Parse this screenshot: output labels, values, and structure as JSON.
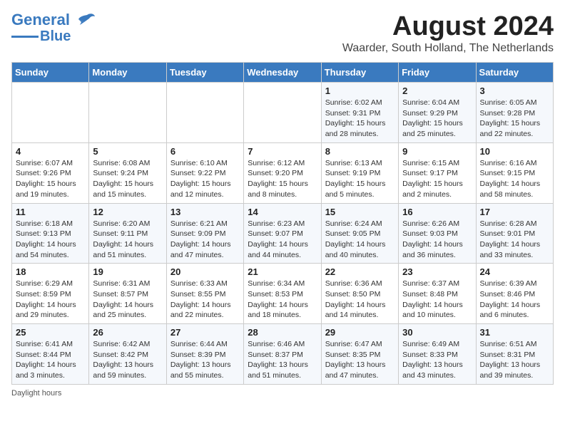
{
  "logo": {
    "line1": "General",
    "line2": "Blue"
  },
  "title": "August 2024",
  "location": "Waarder, South Holland, The Netherlands",
  "days_of_week": [
    "Sunday",
    "Monday",
    "Tuesday",
    "Wednesday",
    "Thursday",
    "Friday",
    "Saturday"
  ],
  "footer": "Daylight hours",
  "weeks": [
    [
      {
        "day": "",
        "info": ""
      },
      {
        "day": "",
        "info": ""
      },
      {
        "day": "",
        "info": ""
      },
      {
        "day": "",
        "info": ""
      },
      {
        "day": "1",
        "info": "Sunrise: 6:02 AM\nSunset: 9:31 PM\nDaylight: 15 hours\nand 28 minutes."
      },
      {
        "day": "2",
        "info": "Sunrise: 6:04 AM\nSunset: 9:29 PM\nDaylight: 15 hours\nand 25 minutes."
      },
      {
        "day": "3",
        "info": "Sunrise: 6:05 AM\nSunset: 9:28 PM\nDaylight: 15 hours\nand 22 minutes."
      }
    ],
    [
      {
        "day": "4",
        "info": "Sunrise: 6:07 AM\nSunset: 9:26 PM\nDaylight: 15 hours\nand 19 minutes."
      },
      {
        "day": "5",
        "info": "Sunrise: 6:08 AM\nSunset: 9:24 PM\nDaylight: 15 hours\nand 15 minutes."
      },
      {
        "day": "6",
        "info": "Sunrise: 6:10 AM\nSunset: 9:22 PM\nDaylight: 15 hours\nand 12 minutes."
      },
      {
        "day": "7",
        "info": "Sunrise: 6:12 AM\nSunset: 9:20 PM\nDaylight: 15 hours\nand 8 minutes."
      },
      {
        "day": "8",
        "info": "Sunrise: 6:13 AM\nSunset: 9:19 PM\nDaylight: 15 hours\nand 5 minutes."
      },
      {
        "day": "9",
        "info": "Sunrise: 6:15 AM\nSunset: 9:17 PM\nDaylight: 15 hours\nand 2 minutes."
      },
      {
        "day": "10",
        "info": "Sunrise: 6:16 AM\nSunset: 9:15 PM\nDaylight: 14 hours\nand 58 minutes."
      }
    ],
    [
      {
        "day": "11",
        "info": "Sunrise: 6:18 AM\nSunset: 9:13 PM\nDaylight: 14 hours\nand 54 minutes."
      },
      {
        "day": "12",
        "info": "Sunrise: 6:20 AM\nSunset: 9:11 PM\nDaylight: 14 hours\nand 51 minutes."
      },
      {
        "day": "13",
        "info": "Sunrise: 6:21 AM\nSunset: 9:09 PM\nDaylight: 14 hours\nand 47 minutes."
      },
      {
        "day": "14",
        "info": "Sunrise: 6:23 AM\nSunset: 9:07 PM\nDaylight: 14 hours\nand 44 minutes."
      },
      {
        "day": "15",
        "info": "Sunrise: 6:24 AM\nSunset: 9:05 PM\nDaylight: 14 hours\nand 40 minutes."
      },
      {
        "day": "16",
        "info": "Sunrise: 6:26 AM\nSunset: 9:03 PM\nDaylight: 14 hours\nand 36 minutes."
      },
      {
        "day": "17",
        "info": "Sunrise: 6:28 AM\nSunset: 9:01 PM\nDaylight: 14 hours\nand 33 minutes."
      }
    ],
    [
      {
        "day": "18",
        "info": "Sunrise: 6:29 AM\nSunset: 8:59 PM\nDaylight: 14 hours\nand 29 minutes."
      },
      {
        "day": "19",
        "info": "Sunrise: 6:31 AM\nSunset: 8:57 PM\nDaylight: 14 hours\nand 25 minutes."
      },
      {
        "day": "20",
        "info": "Sunrise: 6:33 AM\nSunset: 8:55 PM\nDaylight: 14 hours\nand 22 minutes."
      },
      {
        "day": "21",
        "info": "Sunrise: 6:34 AM\nSunset: 8:53 PM\nDaylight: 14 hours\nand 18 minutes."
      },
      {
        "day": "22",
        "info": "Sunrise: 6:36 AM\nSunset: 8:50 PM\nDaylight: 14 hours\nand 14 minutes."
      },
      {
        "day": "23",
        "info": "Sunrise: 6:37 AM\nSunset: 8:48 PM\nDaylight: 14 hours\nand 10 minutes."
      },
      {
        "day": "24",
        "info": "Sunrise: 6:39 AM\nSunset: 8:46 PM\nDaylight: 14 hours\nand 6 minutes."
      }
    ],
    [
      {
        "day": "25",
        "info": "Sunrise: 6:41 AM\nSunset: 8:44 PM\nDaylight: 14 hours\nand 3 minutes."
      },
      {
        "day": "26",
        "info": "Sunrise: 6:42 AM\nSunset: 8:42 PM\nDaylight: 13 hours\nand 59 minutes."
      },
      {
        "day": "27",
        "info": "Sunrise: 6:44 AM\nSunset: 8:39 PM\nDaylight: 13 hours\nand 55 minutes."
      },
      {
        "day": "28",
        "info": "Sunrise: 6:46 AM\nSunset: 8:37 PM\nDaylight: 13 hours\nand 51 minutes."
      },
      {
        "day": "29",
        "info": "Sunrise: 6:47 AM\nSunset: 8:35 PM\nDaylight: 13 hours\nand 47 minutes."
      },
      {
        "day": "30",
        "info": "Sunrise: 6:49 AM\nSunset: 8:33 PM\nDaylight: 13 hours\nand 43 minutes."
      },
      {
        "day": "31",
        "info": "Sunrise: 6:51 AM\nSunset: 8:31 PM\nDaylight: 13 hours\nand 39 minutes."
      }
    ]
  ]
}
